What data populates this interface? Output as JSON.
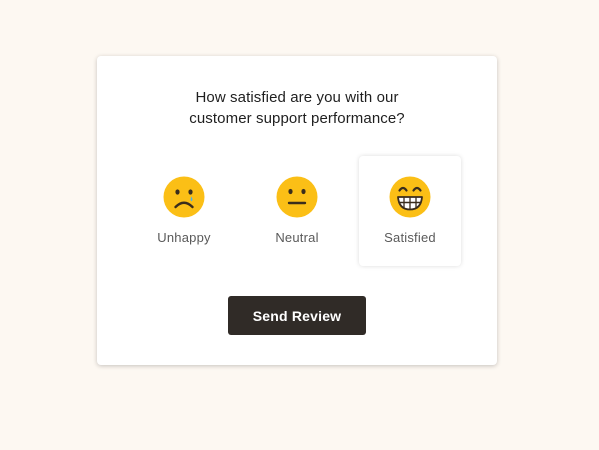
{
  "review": {
    "question_line1": "How satisfied are you with our",
    "question_line2": "customer support performance?",
    "options": [
      {
        "label": "Unhappy",
        "icon": "sad-face-icon",
        "selected": false
      },
      {
        "label": "Neutral",
        "icon": "neutral-face-icon",
        "selected": false
      },
      {
        "label": "Satisfied",
        "icon": "grinning-face-icon",
        "selected": true
      }
    ],
    "submit_label": "Send Review"
  },
  "colors": {
    "page_background": "#fdf8f2",
    "card_background": "#ffffff",
    "emoji_yellow": "#fbbf16",
    "emoji_features": "#3a2d1c",
    "tear": "#4eb4e8",
    "button_background": "#302b27",
    "button_text": "#ffffff"
  }
}
